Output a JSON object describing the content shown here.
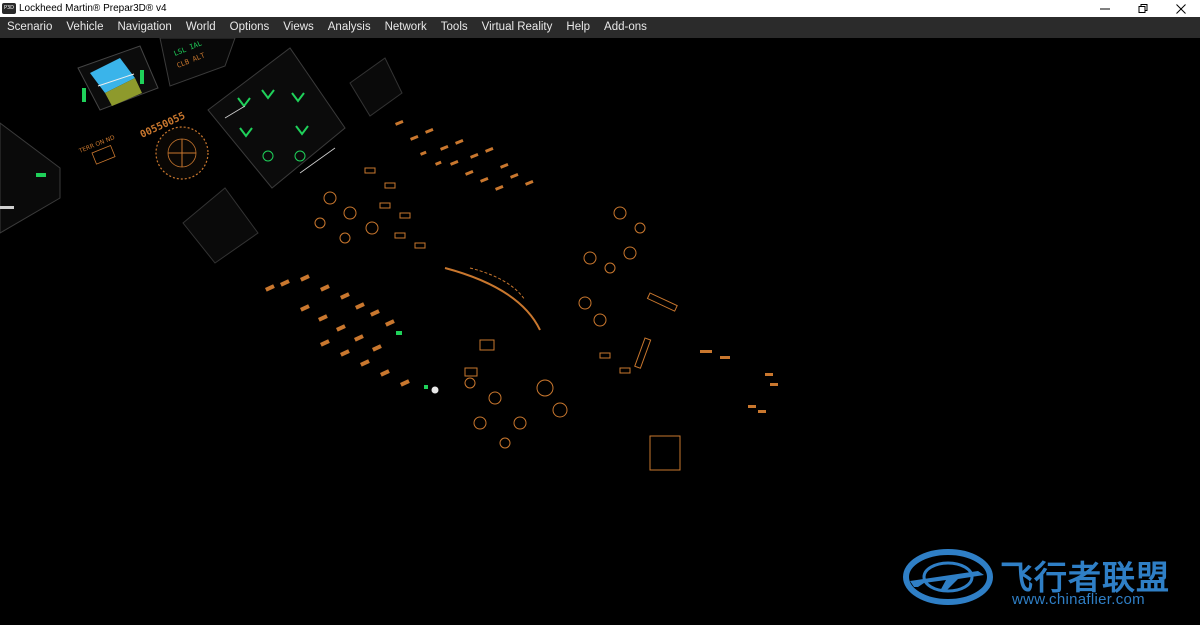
{
  "window": {
    "title": "Lockheed Martin® Prepar3D® v4",
    "icon_label": "P3D",
    "controls": [
      "minimize-icon",
      "restore-icon",
      "close-icon"
    ]
  },
  "menu": [
    {
      "label": "Scenario"
    },
    {
      "label": "Vehicle"
    },
    {
      "label": "Navigation"
    },
    {
      "label": "World"
    },
    {
      "label": "Options"
    },
    {
      "label": "Views"
    },
    {
      "label": "Analysis"
    },
    {
      "label": "Network"
    },
    {
      "label": "Tools"
    },
    {
      "label": "Virtual Reality"
    },
    {
      "label": "Help"
    },
    {
      "label": "Add-ons"
    }
  ],
  "cockpit": {
    "panel_text": {
      "heading_left": "0055",
      "heading_right": "0055",
      "terr_label": "TERR ON ND"
    },
    "colors": {
      "backlight": "#c9772e",
      "display_green": "#1fd15a",
      "display_blue": "#3ab4ea",
      "display_olive": "#8e9a2c"
    }
  },
  "watermark": {
    "text_cn": "飞行者联盟",
    "url": "www.chinaflier.com",
    "color": "#2f7fc6"
  }
}
